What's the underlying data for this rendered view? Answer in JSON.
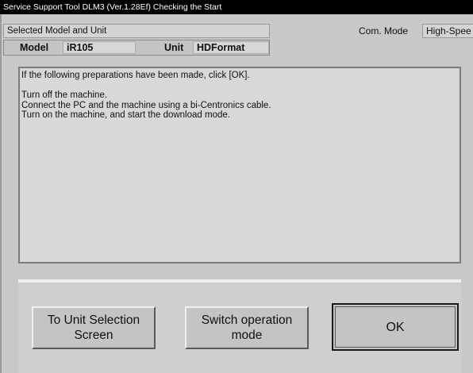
{
  "window": {
    "title": "Service Support Tool DLM3 (Ver.1.28Ef) Checking the Start"
  },
  "selection": {
    "header_label": "Selected Model and Unit",
    "model_label": "Model",
    "model_value": "iR105",
    "unit_label": "Unit",
    "unit_value": "HDFormat"
  },
  "com_mode": {
    "label": "Com. Mode",
    "value": "High-Spee"
  },
  "message": {
    "lines": [
      "If the following preparations have been made, click [OK].",
      "",
      "Turn off the machine.",
      "Connect the PC and the machine using a bi-Centronics cable.",
      "Turn on the machine, and start the download mode."
    ]
  },
  "buttons": {
    "unit_selection": [
      "To Unit Selection",
      "Screen"
    ],
    "switch_mode": [
      "Switch operation",
      "mode"
    ],
    "ok": "OK"
  }
}
